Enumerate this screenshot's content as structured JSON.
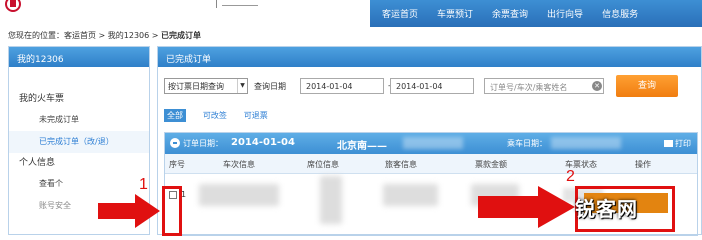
{
  "nav": {
    "items": [
      "客运首页",
      "车票预订",
      "余票查询",
      "出行向导",
      "信息服务"
    ]
  },
  "breadcrumb": {
    "prefix": "您现在的位置：客运首页 > 我的12306 > ",
    "current": "已完成订单"
  },
  "sidebar": {
    "title": "我的12306",
    "group1": "我的火车票",
    "item_unfinished": "未完成订单",
    "item_finished": "已完成订单（改/退）",
    "group2": "个人信息",
    "item_view": "查看个",
    "item_account": "账号安全"
  },
  "main": {
    "title": "已完成订单",
    "filter": {
      "select_value": "按订票日期查询",
      "date_label": "查询日期",
      "date_from": "2014-01-04",
      "date_to": "2014-01-04",
      "search_placeholder": "订单号/车次/乘客姓名",
      "query_button": "查询"
    },
    "tabs": [
      "全部",
      "可改签",
      "可退票"
    ],
    "order": {
      "date_label": "订单日期：",
      "date": "2014-01-04",
      "route": "北京南——",
      "rider_label": "乘车日期：",
      "print_label": "打印",
      "columns": [
        "序号",
        "车次信息",
        "席位信息",
        "旅客信息",
        "票款金额",
        "车票状态",
        "操作"
      ],
      "row_number": "1"
    }
  },
  "annotations": {
    "marker1": "1",
    "marker2": "2",
    "watermark": "锐客网"
  },
  "colors": {
    "nav_blue": "#2a6fb8",
    "header_blue": "#3d8fd4",
    "query_orange": "#f07d10",
    "annotation_red": "#e01010"
  }
}
